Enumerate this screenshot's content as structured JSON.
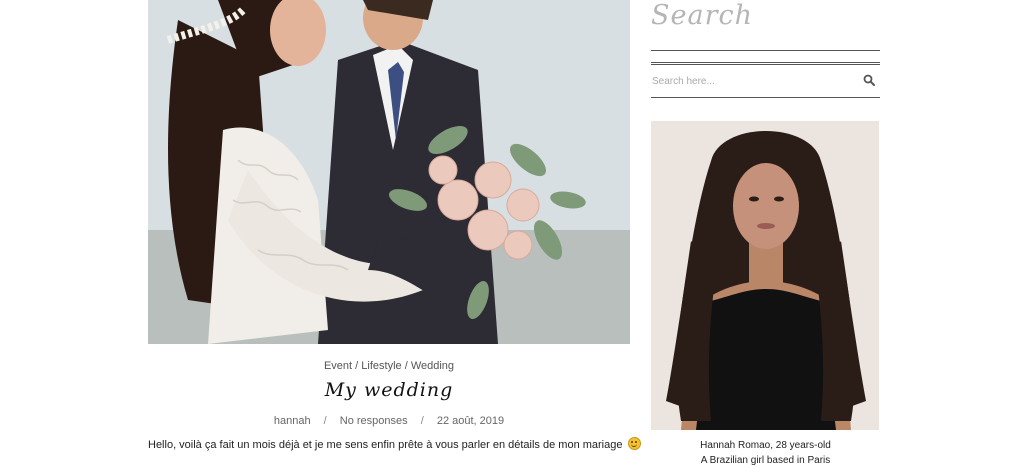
{
  "post": {
    "image_alt": "Bride and groom embracing, bride holding a bouquet",
    "categories": [
      "Event",
      "Lifestyle",
      "Wedding"
    ],
    "category_sep": "/",
    "title": "My wedding",
    "author": "hannah",
    "comments": "No responses",
    "date": "22 août, 2019",
    "meta_sep": "/",
    "excerpt": "Hello, voilà ça fait un mois déjà et je me sens enfin prête à vous parler en détails de mon mariage"
  },
  "sidebar": {
    "search_title": "Search",
    "search_placeholder": "Search here...",
    "profile": {
      "caption_line1": "Hannah Romao, 28 years-old",
      "caption_line2": "A Brazilian girl based in Paris"
    }
  },
  "icons": {
    "search": "search-icon",
    "smiley": "smiley-emoji"
  },
  "colors": {
    "accent": "#333333",
    "widget_title": "#b5b5b5"
  }
}
